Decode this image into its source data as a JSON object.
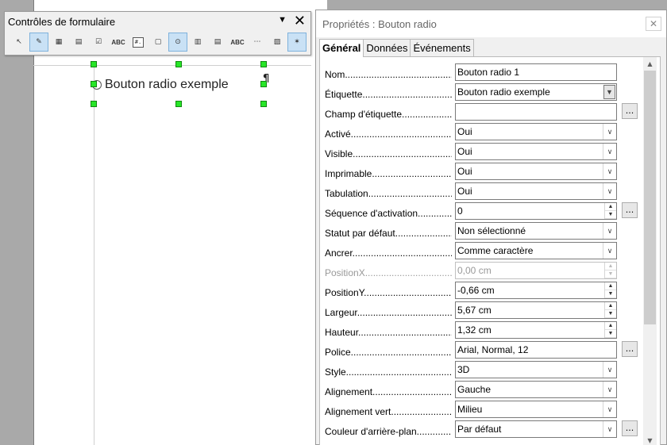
{
  "toolbar": {
    "title": "Contrôles de formulaire",
    "dropdown_icon": "▼",
    "close_icon": "✕",
    "tools": [
      {
        "name": "select-pointer-icon",
        "glyph": "↖",
        "active": false
      },
      {
        "name": "design-mode-icon",
        "glyph": "✎",
        "active": true
      },
      {
        "name": "form-design-icon",
        "glyph": "▦",
        "active": false
      },
      {
        "name": "form-properties-icon",
        "glyph": "▤",
        "active": false
      },
      {
        "name": "checkbox-icon",
        "glyph": "☑",
        "active": false
      },
      {
        "name": "text-box-icon",
        "glyph": "ABC",
        "active": false
      },
      {
        "name": "formatted-field-icon",
        "glyph": "#.",
        "active": false
      },
      {
        "name": "push-button-icon",
        "glyph": "▢",
        "active": false
      },
      {
        "name": "option-button-icon",
        "glyph": "⊙",
        "active": true
      },
      {
        "name": "list-box-icon",
        "glyph": "▥",
        "active": false
      },
      {
        "name": "combo-box-icon",
        "glyph": "▤",
        "active": false
      },
      {
        "name": "label-field-icon",
        "glyph": "ABC",
        "active": false
      },
      {
        "name": "more-controls-icon",
        "glyph": "⋯",
        "active": false
      },
      {
        "name": "form-navigator-icon",
        "glyph": "▨",
        "active": false
      },
      {
        "name": "wizards-icon",
        "glyph": "✶",
        "active": true
      }
    ]
  },
  "document": {
    "radio_label": "Bouton radio exemple",
    "pilcrow": "¶"
  },
  "dialog": {
    "title": "Propriétés : Bouton radio",
    "close_icon": "✕",
    "tabs": [
      "Général",
      "Données",
      "Événements"
    ],
    "properties": [
      {
        "label": "Nom",
        "value": "Bouton radio 1",
        "kind": "text"
      },
      {
        "label": "Étiquette",
        "value": "Bouton radio exemple",
        "kind": "combo-black"
      },
      {
        "label": "Champ d'étiquette",
        "value": "",
        "kind": "text-dots"
      },
      {
        "label": "Activé",
        "value": "Oui",
        "kind": "combo"
      },
      {
        "label": "Visible",
        "value": "Oui",
        "kind": "combo"
      },
      {
        "label": "Imprimable",
        "value": "Oui",
        "kind": "combo"
      },
      {
        "label": "Tabulation",
        "value": "Oui",
        "kind": "combo"
      },
      {
        "label": "Séquence d'activation",
        "value": "0",
        "kind": "spin-dots"
      },
      {
        "label": "Statut par défaut",
        "value": "Non sélectionné",
        "kind": "combo"
      },
      {
        "label": "Ancrer",
        "value": "Comme caractère",
        "kind": "combo"
      },
      {
        "label": "PositionX",
        "value": "0,00 cm",
        "kind": "spin-disabled"
      },
      {
        "label": "PositionY",
        "value": "-0,66 cm",
        "kind": "spin"
      },
      {
        "label": "Largeur",
        "value": "5,67 cm",
        "kind": "spin"
      },
      {
        "label": "Hauteur",
        "value": "1,32 cm",
        "kind": "spin"
      },
      {
        "label": "Police",
        "value": "Arial, Normal, 12",
        "kind": "text-dots"
      },
      {
        "label": "Style",
        "value": "3D",
        "kind": "combo"
      },
      {
        "label": "Alignement",
        "value": "Gauche",
        "kind": "combo"
      },
      {
        "label": "Alignement vert",
        "value": "Milieu",
        "kind": "combo"
      },
      {
        "label": "Couleur d'arrière-plan",
        "value": "Par défaut",
        "kind": "combo-dots"
      }
    ],
    "dots_label": "...",
    "combo_arrow": "∨",
    "spin_up": "▲",
    "spin_down": "▼",
    "scroll_up": "▲",
    "scroll_down": "▼"
  }
}
